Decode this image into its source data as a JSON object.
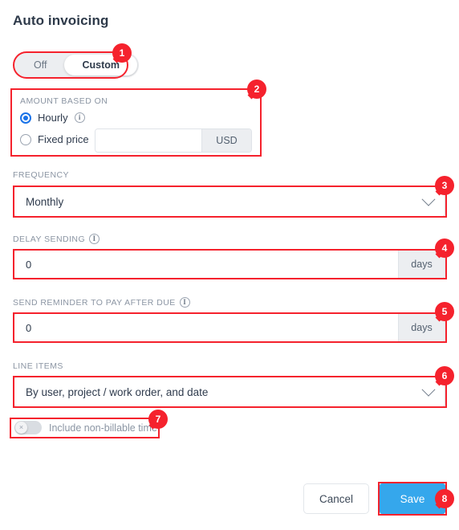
{
  "page": {
    "title": "Auto invoicing"
  },
  "mode_toggle": {
    "options": [
      {
        "label": "Off",
        "selected": false
      },
      {
        "label": "Custom",
        "selected": true
      }
    ]
  },
  "amount_based_on": {
    "label": "AMOUNT BASED ON",
    "options": [
      {
        "label": "Hourly",
        "selected": true,
        "info_icon": "info-icon"
      },
      {
        "label": "Fixed price",
        "selected": false
      }
    ],
    "fixed_price_value": "",
    "fixed_price_placeholder": "",
    "currency_suffix": "USD"
  },
  "frequency": {
    "label": "FREQUENCY",
    "value": "Monthly",
    "icon": "chevron-down-icon"
  },
  "delay_sending": {
    "label": "DELAY SENDING",
    "info_icon": "info-icon",
    "value": "0",
    "suffix": "days"
  },
  "send_reminder": {
    "label": "SEND REMINDER TO PAY AFTER DUE",
    "info_icon": "info-icon",
    "value": "0",
    "suffix": "days"
  },
  "line_items": {
    "label": "LINE ITEMS",
    "value": "By user, project / work order, and date",
    "icon": "chevron-down-icon"
  },
  "include_non_billable": {
    "label": "Include non-billable time",
    "enabled": false,
    "knob_glyph": "×"
  },
  "footer": {
    "cancel_label": "Cancel",
    "save_label": "Save"
  },
  "annotations": {
    "badges": [
      "1",
      "2",
      "3",
      "4",
      "5",
      "6",
      "7",
      "8"
    ]
  },
  "colors": {
    "highlight": "#f5222d",
    "primary_action": "#35a7ec",
    "radio_accent": "#1a73e8",
    "title": "#2e3a4a",
    "label": "#8b95a3"
  }
}
